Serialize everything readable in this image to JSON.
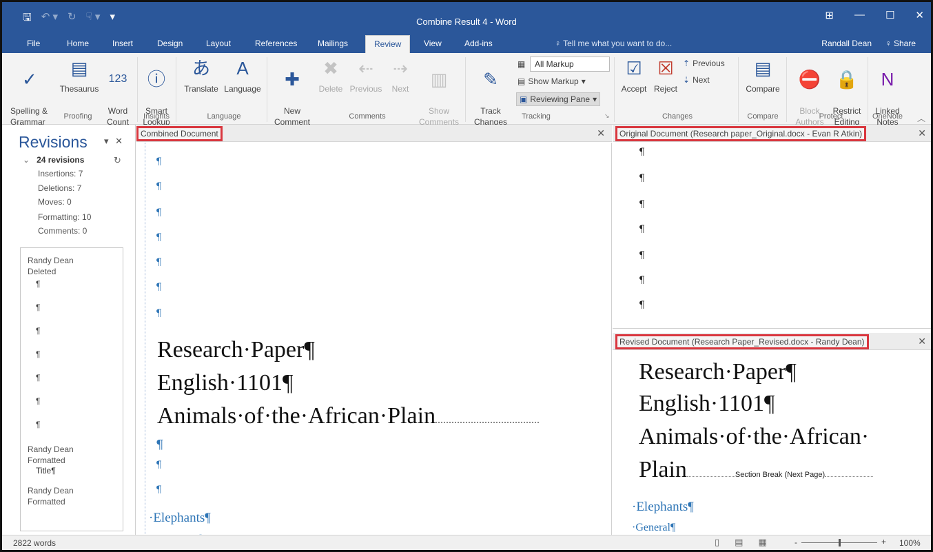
{
  "window": {
    "title": "Combine Result 4 - Word",
    "minimize": "—",
    "maximize": "☐",
    "close": "✕",
    "ribbon_display": "⊞"
  },
  "qat": {
    "save": "🖫",
    "undo": "↶ ▾",
    "redo": "↻",
    "touch": "☟ ▾",
    "customize": "▾"
  },
  "tabs": [
    "File",
    "Home",
    "Insert",
    "Design",
    "Layout",
    "References",
    "Mailings",
    "Review",
    "View",
    "Add-ins"
  ],
  "active_tab": "Review",
  "tell_me": "♀ Tell me what you want to do...",
  "user": "Randall Dean",
  "share": "♀ Share",
  "ribbon": {
    "spelling": "Spelling &\nGrammar",
    "thesaurus": "Thesaurus",
    "word_count": "Word\nCount",
    "smart_lookup": "Smart\nLookup",
    "translate": "Translate",
    "language": "Language",
    "new_comment": "New\nComment",
    "delete": "Delete",
    "previous": "Previous",
    "next": "Next",
    "show_comments": "Show\nComments",
    "track_changes": "Track\nChanges",
    "all_markup": "All Markup",
    "show_markup": "Show Markup",
    "reviewing_pane": "Reviewing Pane",
    "accept": "Accept",
    "reject": "Reject",
    "change_previous": "Previous",
    "change_next": "Next",
    "compare": "Compare",
    "block_authors": "Block\nAuthors",
    "restrict_editing": "Restrict\nEditing",
    "linked_notes": "Linked\nNotes",
    "groups": {
      "proofing": "Proofing",
      "insights": "Insights",
      "language": "Language",
      "comments": "Comments",
      "tracking": "Tracking",
      "changes": "Changes",
      "compare": "Compare",
      "protect": "Protect",
      "onenote": "OneNote"
    }
  },
  "revisions_pane": {
    "title": "Revisions",
    "total": "24 revisions",
    "insertions": "Insertions: 7",
    "deletions": "Deletions: 7",
    "moves": "Moves: 0",
    "formatting": "Formatting: 10",
    "comments": "Comments: 0",
    "author1": "Randy Dean",
    "action1": "Deleted",
    "author2": "Randy Dean",
    "action2": "Formatted",
    "item2": "Title¶",
    "author3": "Randy Dean",
    "action3": "Formatted"
  },
  "panes": {
    "combined": "Combined Document",
    "original": "Original Document (Research paper_Original.docx - Evan R Atkin)",
    "revised": "Revised Document (Research Paper_Revised.docx - Randy Dean)"
  },
  "document": {
    "pilcrow": "¶",
    "line1": "Research·Paper¶",
    "line2": "English·1101¶",
    "line3": "Animals·of·the·African·Plain",
    "revised_line3a": "Animals·of·the·African·",
    "revised_line3b": "Plain",
    "section_break": "Section Break (Next Page)",
    "heading1": "·Elephants¶",
    "heading2": "·General¶"
  },
  "status": {
    "words": "2822 words",
    "zoom": "100%",
    "zoom_minus": "-",
    "zoom_plus": "+"
  }
}
